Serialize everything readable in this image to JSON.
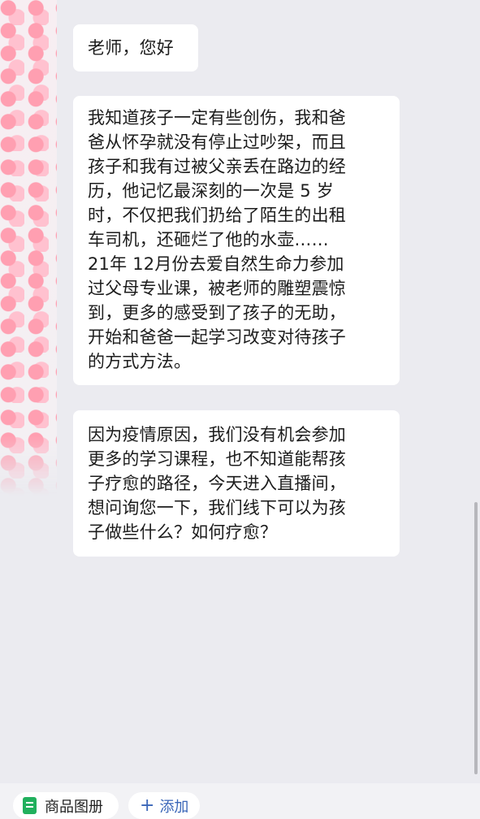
{
  "messages": [
    {
      "text": "老师，您好"
    },
    {
      "text": "我知道孩子一定有些创伤，我和爸\n爸从怀孕就没有停止过吵架，而且\n孩子和我有过被父亲丢在路边的经\n历，他记忆最深刻的一次是 5 岁\n时，不仅把我们扔给了陌生的出租\n车司机，还砸烂了他的水壶……\n21年 12月份去爱自然生命力参加\n过父母专业课，被老师的雕塑震惊\n到，更多的感受到了孩子的无助，\n开始和爸爸一起学习改变对待孩子\n的方式方法。"
    },
    {
      "text": "因为疫情原因，我们没有机会参加\n更多的学习课程，也不知道能帮孩\n子疗愈的路径，今天进入直播间，\n想问询您一下，我们线下可以为孩\n子做些什么？如何疗愈？"
    }
  ],
  "bottom_bar": {
    "catalog_label": "商品图册",
    "catalog_icon": "document-icon",
    "add_label": "添加",
    "add_icon": "plus-icon"
  },
  "colors": {
    "background": "#ebebf0",
    "bubble": "#ffffff",
    "accent_green": "#21b05d",
    "add_blue": "#3a66b8"
  }
}
